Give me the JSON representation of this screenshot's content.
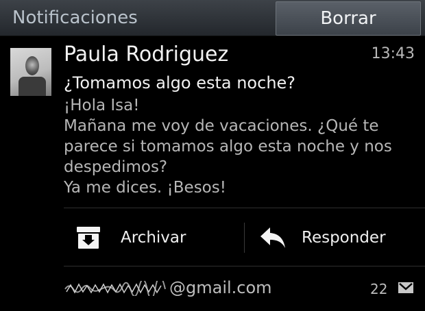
{
  "header": {
    "title": "Notificaciones",
    "clear_label": "Borrar"
  },
  "notification": {
    "sender": "Paula Rodriguez",
    "time": "13:43",
    "subject": "¿Tomamos algo esta noche?",
    "body_lines": [
      "¡Hola Isa!",
      "Mañana me voy de vacaciones. ¿Qué te",
      "parece si tomamos algo esta noche y nos",
      "despedimos?",
      "Ya me dices. ¡Besos!"
    ],
    "actions": {
      "archive_label": "Archivar",
      "reply_label": "Responder"
    },
    "account_suffix": "@gmail.com",
    "unread_count": "22"
  },
  "icons": {
    "archive": "archive-icon",
    "reply": "reply-icon",
    "mail": "mail-icon"
  },
  "colors": {
    "background": "#000000",
    "header": "#2e3338",
    "clear_button": "#4b5158",
    "primary_text": "#f2f2f2",
    "secondary_text": "#b7b7b7"
  }
}
